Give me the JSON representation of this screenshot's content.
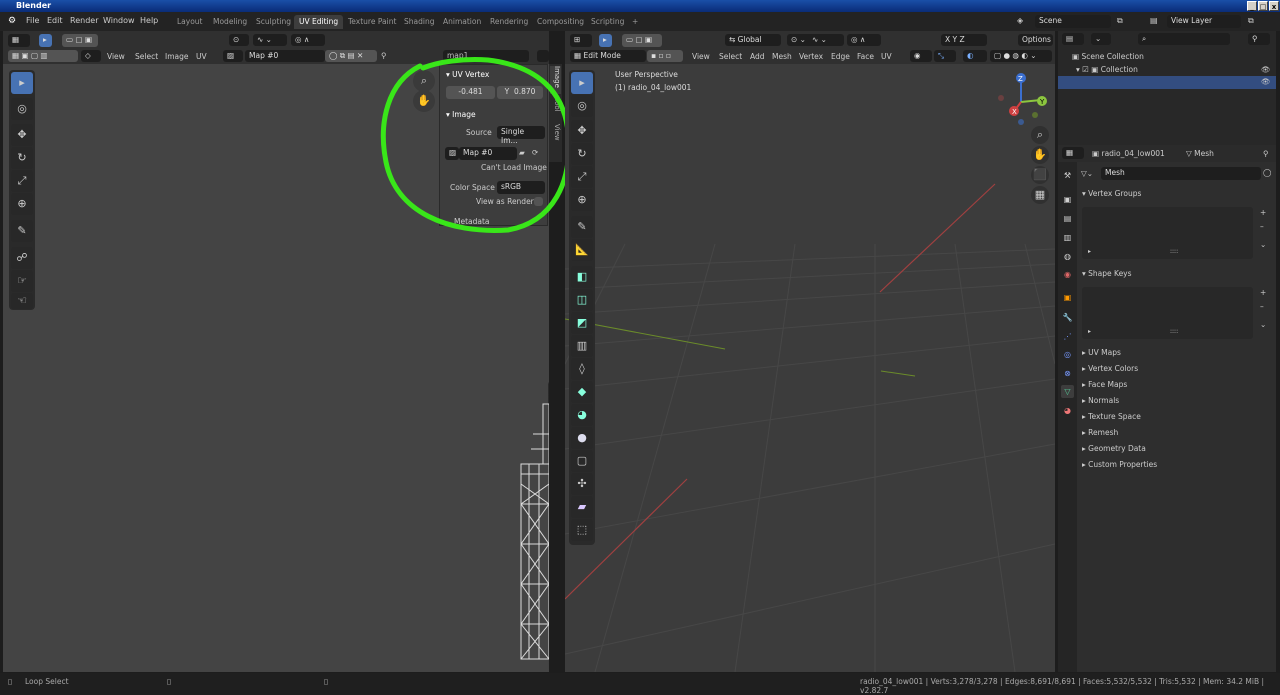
{
  "window": {
    "title": "Blender"
  },
  "menu": [
    "File",
    "Edit",
    "Render",
    "Window",
    "Help"
  ],
  "workspaces": [
    "Layout",
    "Modeling",
    "Sculpting",
    "UV Editing",
    "Texture Paint",
    "Shading",
    "Animation",
    "Rendering",
    "Compositing",
    "Scripting",
    "+"
  ],
  "scene": {
    "label": "Scene",
    "view_layer": "View Layer"
  },
  "uv_editor": {
    "menus": [
      "View",
      "Select",
      "Image",
      "UV"
    ],
    "image_name": "Map #0",
    "uvmap_name": "map1",
    "tabs": [
      "Image",
      "Tool",
      "View"
    ],
    "uv_vertex": {
      "title": "UV Vertex",
      "x": "-0.481",
      "y_label": "Y",
      "y": "0.870"
    },
    "image_panel": {
      "title": "Image",
      "source_label": "Source",
      "source_value": "Single Im...",
      "image": "Map #0",
      "error": "Can't Load Image",
      "color_space_label": "Color Space",
      "color_space_value": "sRGB",
      "view_as_render": "View as Render",
      "metadata": "Metadata"
    }
  },
  "viewport": {
    "mode": "Edit Mode",
    "menus": [
      "View",
      "Select",
      "Add",
      "Mesh",
      "Vertex",
      "Edge",
      "Face",
      "UV"
    ],
    "orientation": "Global",
    "options": "Options",
    "overlay_text1": "User Perspective",
    "overlay_text2": "(1) radio_04_low001",
    "axes": [
      "X",
      "Y",
      "Z"
    ]
  },
  "outliner": {
    "scene_collection": "Scene Collection",
    "collection": "Collection"
  },
  "properties": {
    "object": "radio_04_low001",
    "data": "Mesh",
    "mesh_name": "Mesh",
    "sections": [
      "Vertex Groups",
      "Shape Keys",
      "UV Maps",
      "Vertex Colors",
      "Face Maps",
      "Normals",
      "Texture Space",
      "Remesh",
      "Geometry Data",
      "Custom Properties"
    ]
  },
  "status": {
    "left": "Loop Select",
    "right": "radio_04_low001 | Verts:3,278/3,278 | Edges:8,691/8,691 | Faces:5,532/5,532 | Tris:5,532 | Mem: 34.2 MiB | v2.82.7"
  },
  "colors": {
    "accent": "#4772b3",
    "highlight_circle": "#39e619",
    "selected_row": "#334d80"
  }
}
